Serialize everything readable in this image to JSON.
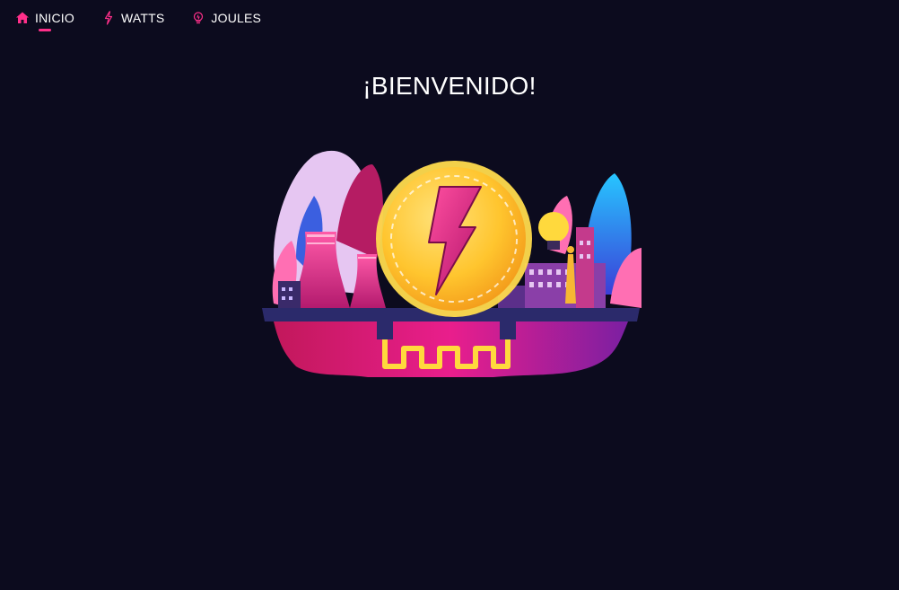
{
  "nav": {
    "items": [
      {
        "label": "INICIO",
        "icon": "home-icon",
        "active": true
      },
      {
        "label": "WATTS",
        "icon": "bolt-icon",
        "active": false
      },
      {
        "label": "JOULES",
        "icon": "bulb-icon",
        "active": false
      }
    ],
    "accent": "#ff2f8a"
  },
  "main": {
    "title": "¡BIENVENIDO!"
  },
  "colors": {
    "background": "#0c0b1e",
    "accent": "#ff2f8a",
    "text": "#ffffff"
  }
}
